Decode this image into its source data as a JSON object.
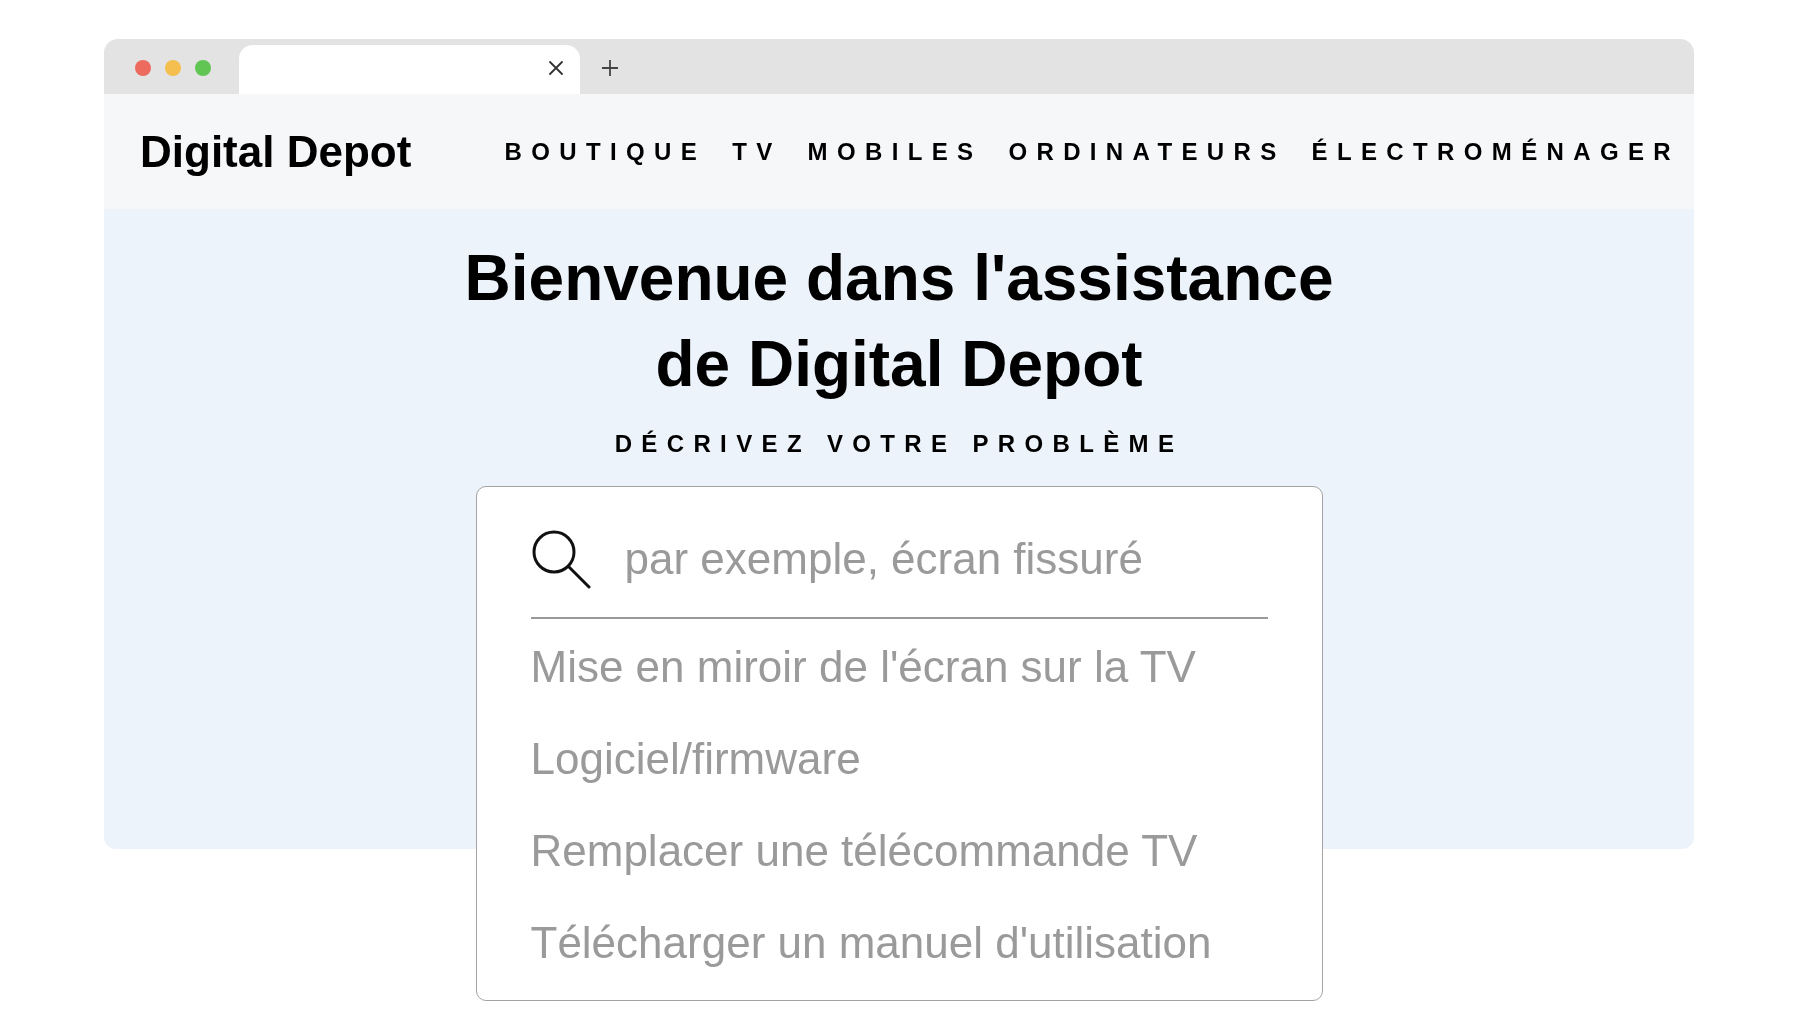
{
  "site": {
    "logo": "Digital Depot",
    "nav": [
      "BOUTIQUE",
      "TV",
      "MOBILES",
      "ORDINATEURS",
      "ÉLECTROMÉNAGER"
    ]
  },
  "hero": {
    "title": "Bienvenue dans l'assistance de Digital Depot",
    "subtitle": "DÉCRIVEZ VOTRE PROBLÈME"
  },
  "search": {
    "placeholder": "par exemple, écran fissuré",
    "suggestions": [
      "Mise en miroir de l'écran sur la TV",
      "Logiciel/firmware",
      "Remplacer une télécommande TV",
      "Télécharger un manuel d'utilisation"
    ]
  }
}
